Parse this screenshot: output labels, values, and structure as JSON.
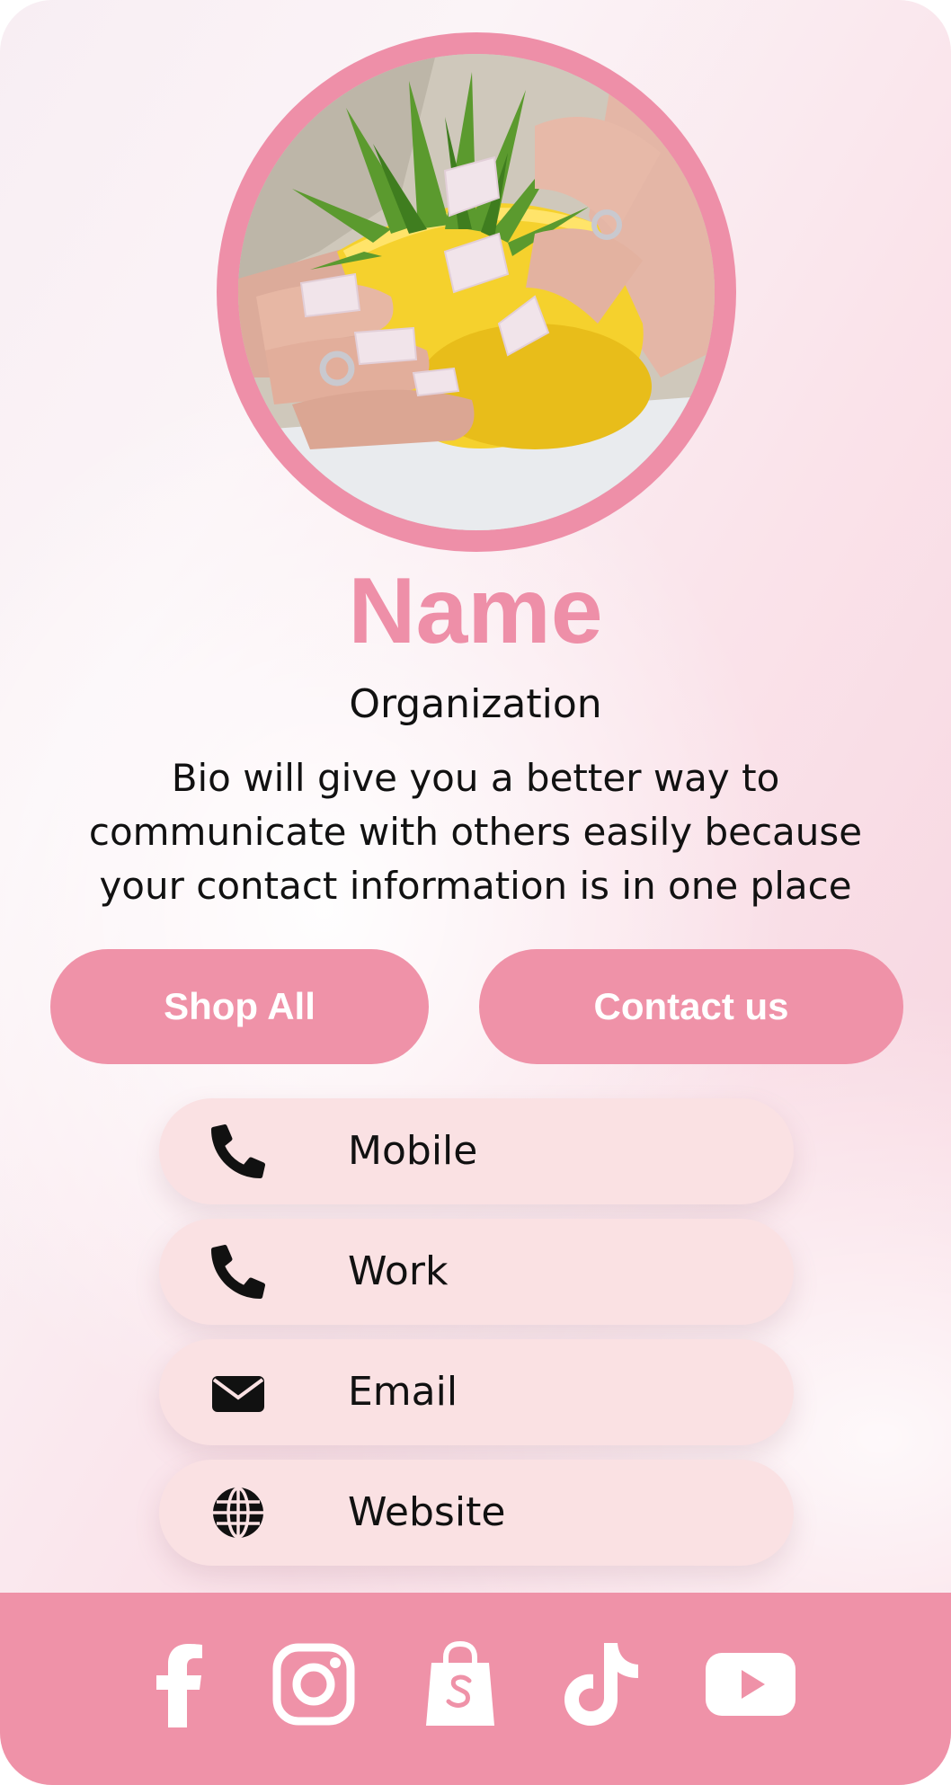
{
  "profile": {
    "name": "Name",
    "organization": "Organization",
    "bio": "Bio will give you a better way to communicate with others easily because your contact information is in one place",
    "avatar_alt": ""
  },
  "actions": {
    "shop_label": "Shop All",
    "contact_label": "Contact us"
  },
  "contact_rows": [
    {
      "label": "Mobile",
      "icon": "phone-icon"
    },
    {
      "label": "Work",
      "icon": "phone-icon"
    },
    {
      "label": "Email",
      "icon": "envelope-icon"
    },
    {
      "label": "Website",
      "icon": "globe-icon"
    }
  ],
  "social": [
    {
      "icon": "facebook-icon"
    },
    {
      "icon": "instagram-icon"
    },
    {
      "icon": "shopify-icon"
    },
    {
      "icon": "tiktok-icon"
    },
    {
      "icon": "youtube-icon"
    }
  ],
  "colors": {
    "accent_pink": "#ee8fa8",
    "row_background": "#fae1e3",
    "text": "#111111",
    "white": "#ffffff"
  }
}
